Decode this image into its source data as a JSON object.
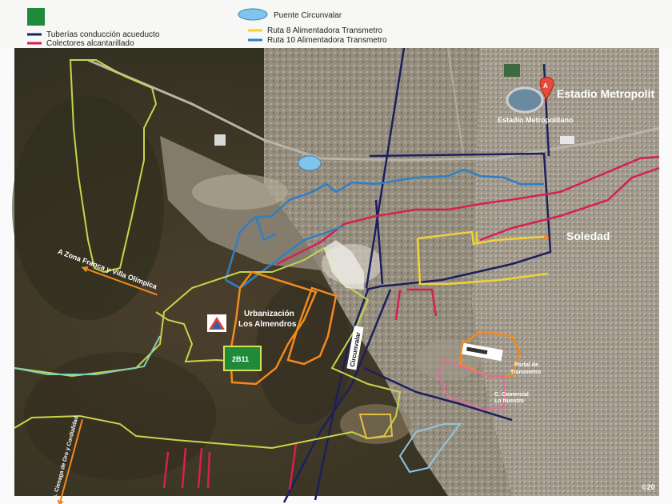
{
  "legend": {
    "items": [
      {
        "label": "Tuberías conducción acueducto",
        "color": "#1c1f5e"
      },
      {
        "label": "Colectores alcantarillado",
        "color": "#d6204f"
      },
      {
        "label": "Puente Circunvalar",
        "color": "#7fc4ec"
      },
      {
        "label": "Ruta 8 Alimentadora Transmetro",
        "color": "#f0d23a"
      },
      {
        "label": "Ruta 10 Alimentadora Transmetro",
        "color": "#2f7fc6"
      }
    ],
    "green_color": "#1f8a3a"
  },
  "labels": {
    "stadium_title": "Estadio Metropolit",
    "stadium_pin": "Estadio Metropolitano",
    "pin_letter": "A",
    "soledad": "Soledad",
    "zona_franca": "A Zona Franca y Villa Olímpica",
    "urbanizacion": "Urbanización\nLos Almendros",
    "urbanizacion_l1": "Urbanización",
    "urbanizacion_l2": "Los Almendros",
    "lot_code": "2B11",
    "portal": "Portal de\nTransmetro",
    "portal_l1": "Portal de",
    "portal_l2": "Transmetro",
    "comercial_l1": "C. Comercial",
    "comercial_l2": "Lo Nuestro",
    "circunvalar": "Circunvalar",
    "cordialidad": "A. Cienaga de Oro y Cordialidad",
    "copyright": "©20"
  }
}
